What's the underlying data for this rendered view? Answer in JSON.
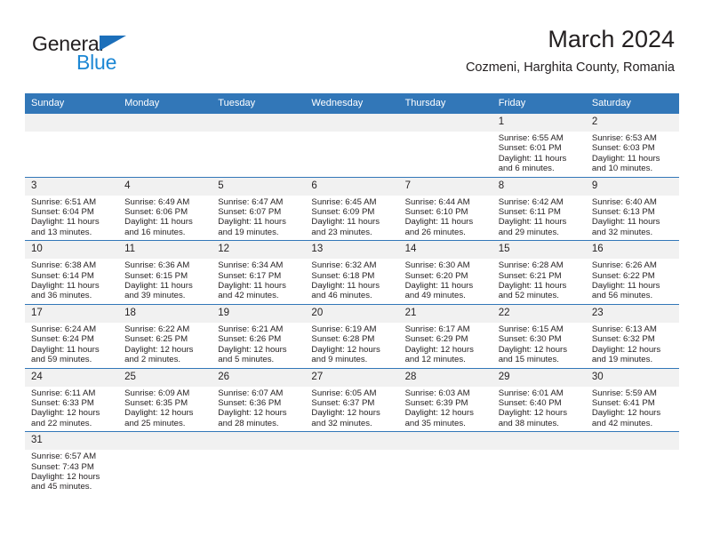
{
  "brand": {
    "name_part1": "General",
    "name_part2": "Blue",
    "flag_icon": "triangle-flag-icon",
    "accent_color": "#1c6fba",
    "blue_text_color": "#1c87d4"
  },
  "header": {
    "title": "March 2024",
    "subtitle": "Cozmeni, Harghita County, Romania"
  },
  "calendar": {
    "header_bg_color": "#3277b8",
    "daynum_bg_color": "#f1f1f1",
    "grid_line_color": "#3277b8",
    "weekday_headers": [
      "Sunday",
      "Monday",
      "Tuesday",
      "Wednesday",
      "Thursday",
      "Friday",
      "Saturday"
    ],
    "weeks": [
      [
        {
          "day": "",
          "sunrise": "",
          "sunset": "",
          "daylight_line1": "",
          "daylight_line2": ""
        },
        {
          "day": "",
          "sunrise": "",
          "sunset": "",
          "daylight_line1": "",
          "daylight_line2": ""
        },
        {
          "day": "",
          "sunrise": "",
          "sunset": "",
          "daylight_line1": "",
          "daylight_line2": ""
        },
        {
          "day": "",
          "sunrise": "",
          "sunset": "",
          "daylight_line1": "",
          "daylight_line2": ""
        },
        {
          "day": "",
          "sunrise": "",
          "sunset": "",
          "daylight_line1": "",
          "daylight_line2": ""
        },
        {
          "day": "1",
          "sunrise": "Sunrise: 6:55 AM",
          "sunset": "Sunset: 6:01 PM",
          "daylight_line1": "Daylight: 11 hours",
          "daylight_line2": "and 6 minutes."
        },
        {
          "day": "2",
          "sunrise": "Sunrise: 6:53 AM",
          "sunset": "Sunset: 6:03 PM",
          "daylight_line1": "Daylight: 11 hours",
          "daylight_line2": "and 10 minutes."
        }
      ],
      [
        {
          "day": "3",
          "sunrise": "Sunrise: 6:51 AM",
          "sunset": "Sunset: 6:04 PM",
          "daylight_line1": "Daylight: 11 hours",
          "daylight_line2": "and 13 minutes."
        },
        {
          "day": "4",
          "sunrise": "Sunrise: 6:49 AM",
          "sunset": "Sunset: 6:06 PM",
          "daylight_line1": "Daylight: 11 hours",
          "daylight_line2": "and 16 minutes."
        },
        {
          "day": "5",
          "sunrise": "Sunrise: 6:47 AM",
          "sunset": "Sunset: 6:07 PM",
          "daylight_line1": "Daylight: 11 hours",
          "daylight_line2": "and 19 minutes."
        },
        {
          "day": "6",
          "sunrise": "Sunrise: 6:45 AM",
          "sunset": "Sunset: 6:09 PM",
          "daylight_line1": "Daylight: 11 hours",
          "daylight_line2": "and 23 minutes."
        },
        {
          "day": "7",
          "sunrise": "Sunrise: 6:44 AM",
          "sunset": "Sunset: 6:10 PM",
          "daylight_line1": "Daylight: 11 hours",
          "daylight_line2": "and 26 minutes."
        },
        {
          "day": "8",
          "sunrise": "Sunrise: 6:42 AM",
          "sunset": "Sunset: 6:11 PM",
          "daylight_line1": "Daylight: 11 hours",
          "daylight_line2": "and 29 minutes."
        },
        {
          "day": "9",
          "sunrise": "Sunrise: 6:40 AM",
          "sunset": "Sunset: 6:13 PM",
          "daylight_line1": "Daylight: 11 hours",
          "daylight_line2": "and 32 minutes."
        }
      ],
      [
        {
          "day": "10",
          "sunrise": "Sunrise: 6:38 AM",
          "sunset": "Sunset: 6:14 PM",
          "daylight_line1": "Daylight: 11 hours",
          "daylight_line2": "and 36 minutes."
        },
        {
          "day": "11",
          "sunrise": "Sunrise: 6:36 AM",
          "sunset": "Sunset: 6:15 PM",
          "daylight_line1": "Daylight: 11 hours",
          "daylight_line2": "and 39 minutes."
        },
        {
          "day": "12",
          "sunrise": "Sunrise: 6:34 AM",
          "sunset": "Sunset: 6:17 PM",
          "daylight_line1": "Daylight: 11 hours",
          "daylight_line2": "and 42 minutes."
        },
        {
          "day": "13",
          "sunrise": "Sunrise: 6:32 AM",
          "sunset": "Sunset: 6:18 PM",
          "daylight_line1": "Daylight: 11 hours",
          "daylight_line2": "and 46 minutes."
        },
        {
          "day": "14",
          "sunrise": "Sunrise: 6:30 AM",
          "sunset": "Sunset: 6:20 PM",
          "daylight_line1": "Daylight: 11 hours",
          "daylight_line2": "and 49 minutes."
        },
        {
          "day": "15",
          "sunrise": "Sunrise: 6:28 AM",
          "sunset": "Sunset: 6:21 PM",
          "daylight_line1": "Daylight: 11 hours",
          "daylight_line2": "and 52 minutes."
        },
        {
          "day": "16",
          "sunrise": "Sunrise: 6:26 AM",
          "sunset": "Sunset: 6:22 PM",
          "daylight_line1": "Daylight: 11 hours",
          "daylight_line2": "and 56 minutes."
        }
      ],
      [
        {
          "day": "17",
          "sunrise": "Sunrise: 6:24 AM",
          "sunset": "Sunset: 6:24 PM",
          "daylight_line1": "Daylight: 11 hours",
          "daylight_line2": "and 59 minutes."
        },
        {
          "day": "18",
          "sunrise": "Sunrise: 6:22 AM",
          "sunset": "Sunset: 6:25 PM",
          "daylight_line1": "Daylight: 12 hours",
          "daylight_line2": "and 2 minutes."
        },
        {
          "day": "19",
          "sunrise": "Sunrise: 6:21 AM",
          "sunset": "Sunset: 6:26 PM",
          "daylight_line1": "Daylight: 12 hours",
          "daylight_line2": "and 5 minutes."
        },
        {
          "day": "20",
          "sunrise": "Sunrise: 6:19 AM",
          "sunset": "Sunset: 6:28 PM",
          "daylight_line1": "Daylight: 12 hours",
          "daylight_line2": "and 9 minutes."
        },
        {
          "day": "21",
          "sunrise": "Sunrise: 6:17 AM",
          "sunset": "Sunset: 6:29 PM",
          "daylight_line1": "Daylight: 12 hours",
          "daylight_line2": "and 12 minutes."
        },
        {
          "day": "22",
          "sunrise": "Sunrise: 6:15 AM",
          "sunset": "Sunset: 6:30 PM",
          "daylight_line1": "Daylight: 12 hours",
          "daylight_line2": "and 15 minutes."
        },
        {
          "day": "23",
          "sunrise": "Sunrise: 6:13 AM",
          "sunset": "Sunset: 6:32 PM",
          "daylight_line1": "Daylight: 12 hours",
          "daylight_line2": "and 19 minutes."
        }
      ],
      [
        {
          "day": "24",
          "sunrise": "Sunrise: 6:11 AM",
          "sunset": "Sunset: 6:33 PM",
          "daylight_line1": "Daylight: 12 hours",
          "daylight_line2": "and 22 minutes."
        },
        {
          "day": "25",
          "sunrise": "Sunrise: 6:09 AM",
          "sunset": "Sunset: 6:35 PM",
          "daylight_line1": "Daylight: 12 hours",
          "daylight_line2": "and 25 minutes."
        },
        {
          "day": "26",
          "sunrise": "Sunrise: 6:07 AM",
          "sunset": "Sunset: 6:36 PM",
          "daylight_line1": "Daylight: 12 hours",
          "daylight_line2": "and 28 minutes."
        },
        {
          "day": "27",
          "sunrise": "Sunrise: 6:05 AM",
          "sunset": "Sunset: 6:37 PM",
          "daylight_line1": "Daylight: 12 hours",
          "daylight_line2": "and 32 minutes."
        },
        {
          "day": "28",
          "sunrise": "Sunrise: 6:03 AM",
          "sunset": "Sunset: 6:39 PM",
          "daylight_line1": "Daylight: 12 hours",
          "daylight_line2": "and 35 minutes."
        },
        {
          "day": "29",
          "sunrise": "Sunrise: 6:01 AM",
          "sunset": "Sunset: 6:40 PM",
          "daylight_line1": "Daylight: 12 hours",
          "daylight_line2": "and 38 minutes."
        },
        {
          "day": "30",
          "sunrise": "Sunrise: 5:59 AM",
          "sunset": "Sunset: 6:41 PM",
          "daylight_line1": "Daylight: 12 hours",
          "daylight_line2": "and 42 minutes."
        }
      ],
      [
        {
          "day": "31",
          "sunrise": "Sunrise: 6:57 AM",
          "sunset": "Sunset: 7:43 PM",
          "daylight_line1": "Daylight: 12 hours",
          "daylight_line2": "and 45 minutes."
        },
        {
          "day": "",
          "sunrise": "",
          "sunset": "",
          "daylight_line1": "",
          "daylight_line2": ""
        },
        {
          "day": "",
          "sunrise": "",
          "sunset": "",
          "daylight_line1": "",
          "daylight_line2": ""
        },
        {
          "day": "",
          "sunrise": "",
          "sunset": "",
          "daylight_line1": "",
          "daylight_line2": ""
        },
        {
          "day": "",
          "sunrise": "",
          "sunset": "",
          "daylight_line1": "",
          "daylight_line2": ""
        },
        {
          "day": "",
          "sunrise": "",
          "sunset": "",
          "daylight_line1": "",
          "daylight_line2": ""
        },
        {
          "day": "",
          "sunrise": "",
          "sunset": "",
          "daylight_line1": "",
          "daylight_line2": ""
        }
      ]
    ]
  }
}
